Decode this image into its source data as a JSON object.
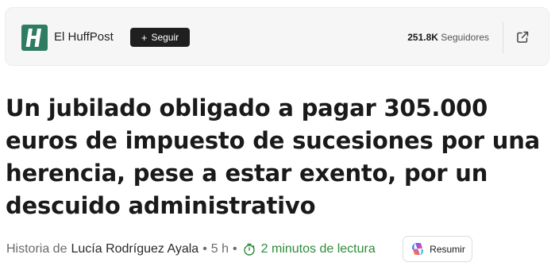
{
  "publisher": {
    "logo_letter": "H",
    "name": "El HuffPost",
    "follow_label": "Seguir",
    "followers_count": "251.8K",
    "followers_label": "Seguidores"
  },
  "article": {
    "headline": "Un jubilado obligado a pagar 305.000 euros de impuesto de sucesiones por una herencia, pese a estar exento, por un descuido administrativo",
    "byline_prefix": "Historia de",
    "author": "Lucía Rodríguez Ayala",
    "age": "5 h",
    "read_time": "2 minutos de lectura",
    "summarize_label": "Resumir"
  },
  "colors": {
    "logo_bg": "#2e7d62",
    "follow_bg": "#1f1f1f",
    "read_time": "#2e8b3a"
  },
  "icons": {
    "plus": "plus-icon",
    "external": "external-link-icon",
    "clock": "clock-icon",
    "copilot": "copilot-icon"
  }
}
